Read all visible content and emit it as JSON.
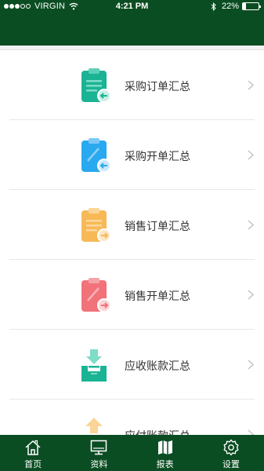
{
  "status_bar": {
    "carrier": "VIRGIN",
    "time": "4:21 PM",
    "battery": "22%",
    "battery_level": 0.22,
    "signal_strength": 3,
    "signal_max": 5
  },
  "report_items": [
    {
      "label": "采购订单汇总",
      "icon": "clipboard-incoming-icon",
      "color": "#1ab394"
    },
    {
      "label": "采购开单汇总",
      "icon": "clipboard-incoming-icon",
      "color": "#29a9f0"
    },
    {
      "label": "销售订单汇总",
      "icon": "clipboard-outgoing-icon",
      "color": "#f7b956"
    },
    {
      "label": "销售开单汇总",
      "icon": "clipboard-outgoing-icon",
      "color": "#f2727a"
    },
    {
      "label": "应收账款汇总",
      "icon": "inbox-download-icon",
      "color": "#1ab394"
    },
    {
      "label": "应付账款汇总",
      "icon": "upload-icon",
      "color": "#f7b956"
    }
  ],
  "tab_bar": {
    "tabs": [
      {
        "label": "首页",
        "icon": "home-icon"
      },
      {
        "label": "资料",
        "icon": "monitor-icon"
      },
      {
        "label": "报表",
        "icon": "map-icon",
        "active": true
      },
      {
        "label": "设置",
        "icon": "gear-icon"
      }
    ]
  }
}
